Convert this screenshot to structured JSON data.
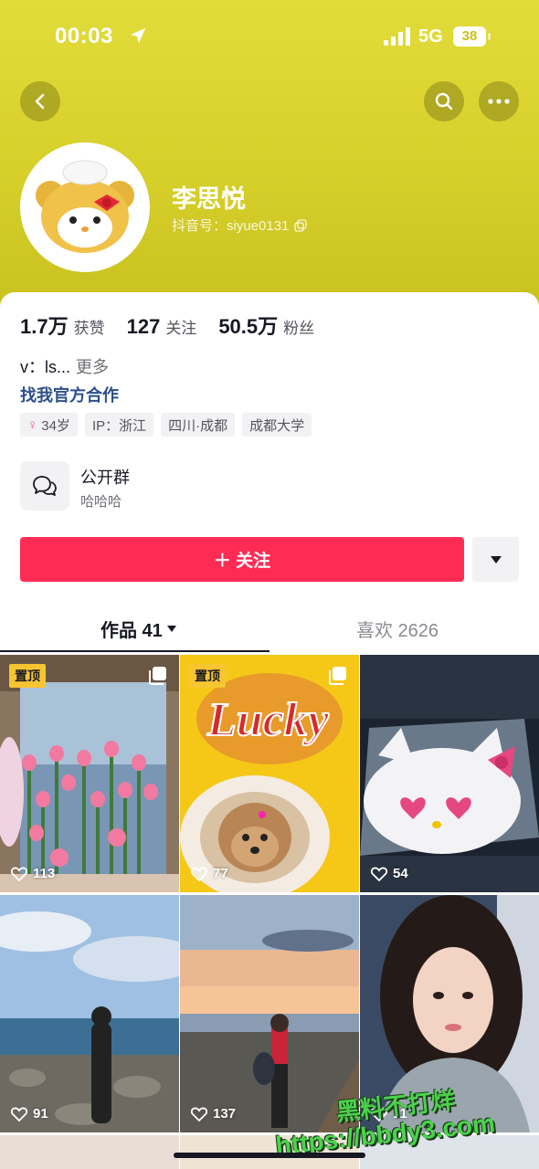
{
  "status_bar": {
    "time": "00:03",
    "network": "5G",
    "battery": "38"
  },
  "profile": {
    "username": "李思悦",
    "douyin_id": "抖音号：siyue0131"
  },
  "stats": [
    {
      "num": "1.7万",
      "label": "获赞"
    },
    {
      "num": "127",
      "label": "关注"
    },
    {
      "num": "50.5万",
      "label": "粉丝"
    }
  ],
  "bio": {
    "text": "v：ls...",
    "more": "更多"
  },
  "collab_link": "找我官方合作",
  "tags": [
    {
      "label": "34岁",
      "icon": "female-icon"
    },
    {
      "label": "IP：浙江"
    },
    {
      "label": "四川·成都"
    },
    {
      "label": "成都大学"
    }
  ],
  "group": {
    "title": "公开群",
    "subtitle": "哈哈哈"
  },
  "follow_button": "＋ 关注",
  "tabs": {
    "works": "作品 41",
    "likes": "喜欢 2626"
  },
  "grid": [
    {
      "likes": "113",
      "pinned": "置顶",
      "multi": true,
      "scene": "tulips"
    },
    {
      "likes": "77",
      "pinned": "置顶",
      "multi": true,
      "scene": "dog"
    },
    {
      "likes": "54",
      "scene": "cake"
    },
    {
      "likes": "91",
      "scene": "sea"
    },
    {
      "likes": "137",
      "scene": "sunset"
    },
    {
      "likes": "11",
      "scene": "portrait"
    }
  ],
  "watermark": {
    "line1": "黑料不打烊",
    "line2": "https://bbdy3.com"
  },
  "colors": {
    "accent": "#fe2c55",
    "header": "#d7cf2a",
    "link": "#2b4e8c",
    "pin": "#f7c531"
  }
}
